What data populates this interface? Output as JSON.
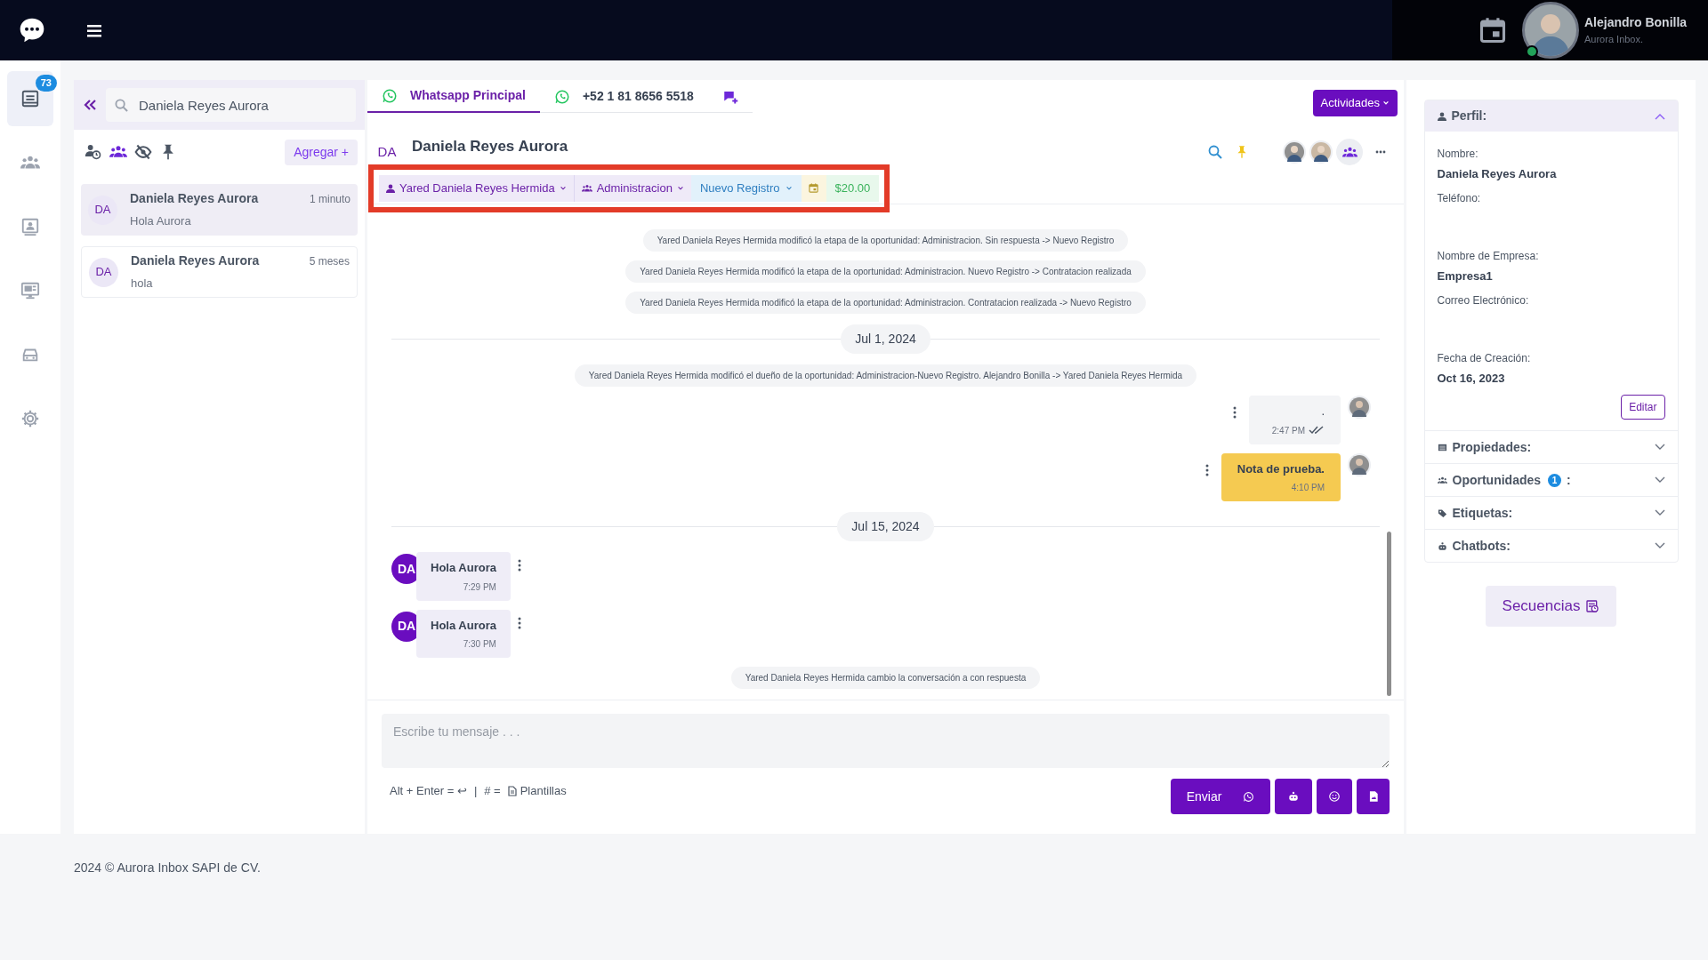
{
  "top_bar": {
    "user_name": "Alejandro Bonilla",
    "user_org": "Aurora Inbox.",
    "online": true
  },
  "rail": [
    {
      "selected": true,
      "badge": "73"
    },
    {
      "selected": false
    },
    {
      "selected": false
    },
    {
      "selected": false
    },
    {
      "selected": false
    },
    {
      "selected": false
    }
  ],
  "conversation_list": {
    "search": "Daniela Reyes Aurora",
    "filters": [
      {
        "selected": false
      },
      {
        "selected": true
      },
      {
        "selected": false
      },
      {
        "selected": false
      }
    ],
    "add_button": "Agregar +",
    "conversations": [
      {
        "initials": "DA",
        "name": "Daniela Reyes Aurora",
        "time": "1 minuto",
        "preview": "Hola Aurora",
        "selected": true
      },
      {
        "initials": "DA",
        "name": "Daniela Reyes Aurora",
        "time": "5 meses",
        "preview": "hola",
        "selected": false
      }
    ]
  },
  "chat": {
    "tabs": [
      {
        "label": "Whatsapp Principal",
        "selected": true
      },
      {
        "label": "+52 1 81 8656 5518",
        "selected": false
      }
    ],
    "actions_button": "Actividades",
    "contact": {
      "initials": "DA",
      "name": "Daniela Reyes Aurora"
    },
    "chips": {
      "highlighted": true,
      "owner": "Yared Daniela Reyes Hermida",
      "team": "Administracion",
      "stage": "Nuevo Registro",
      "amount": "$20.00"
    },
    "messages": [
      {
        "kind": "system",
        "text": "Yared Daniela Reyes Hermida modificó la etapa de la oportunidad: Administracion. Sin respuesta -> Nuevo Registro"
      },
      {
        "kind": "system",
        "text": "Yared Daniela Reyes Hermida modificó la etapa de la oportunidad: Administracion. Nuevo Registro -> Contratacion realizada"
      },
      {
        "kind": "system",
        "text": "Yared Daniela Reyes Hermida modificó la etapa de la oportunidad: Administracion. Contratacion realizada -> Nuevo Registro"
      },
      {
        "kind": "date",
        "text": "Jul 1, 2024"
      },
      {
        "kind": "system",
        "text": "Yared Daniela Reyes Hermida modificó el dueño de la oportunidad: Administracion-Nuevo Registro. Alejandro Bonilla -> Yared Daniela Reyes Hermida"
      },
      {
        "kind": "outgoing",
        "text": ".",
        "time": "2:47 PM",
        "read": true
      },
      {
        "kind": "note",
        "text": "Nota de prueba.",
        "time": "4:10 PM"
      },
      {
        "kind": "date",
        "text": "Jul 15, 2024"
      },
      {
        "kind": "incoming",
        "initials": "DA",
        "text": "Hola Aurora",
        "time": "7:29 PM"
      },
      {
        "kind": "incoming",
        "initials": "DA",
        "text": "Hola Aurora",
        "time": "7:30 PM"
      },
      {
        "kind": "system",
        "text": "Yared Daniela Reyes Hermida cambio la conversación a con respuesta"
      }
    ],
    "composer": {
      "placeholder": "Escribe tu mensaje . . .",
      "shortcut": "Alt + Enter = ↩",
      "separator": "|",
      "template_key": "# =",
      "template_label": "Plantillas",
      "send_button": "Enviar"
    }
  },
  "contact_panel": {
    "profile": {
      "title": "Perfil:",
      "expanded": true,
      "fields": [
        {
          "label": "Nombre:",
          "value": "Daniela Reyes Aurora"
        },
        {
          "label": "Teléfono:"
        },
        {
          "label": "Nombre de Empresa:",
          "value": "Empresa1"
        },
        {
          "label": "Correo Electrónico:"
        },
        {
          "label": "Fecha de Creación:",
          "value": "Oct 16, 2023"
        }
      ],
      "edit_button": "Editar"
    },
    "sections": [
      {
        "title": "Propiedades:",
        "expanded": false
      },
      {
        "title": "Oportunidades",
        "badge": "1",
        "suffix": ":",
        "expanded": false
      },
      {
        "title": "Etiquetas:",
        "expanded": false
      },
      {
        "title": "Chatbots:",
        "expanded": false
      }
    ],
    "sequences_button": "Secuencias"
  },
  "footer": "2024 © Aurora Inbox SAPI de CV."
}
